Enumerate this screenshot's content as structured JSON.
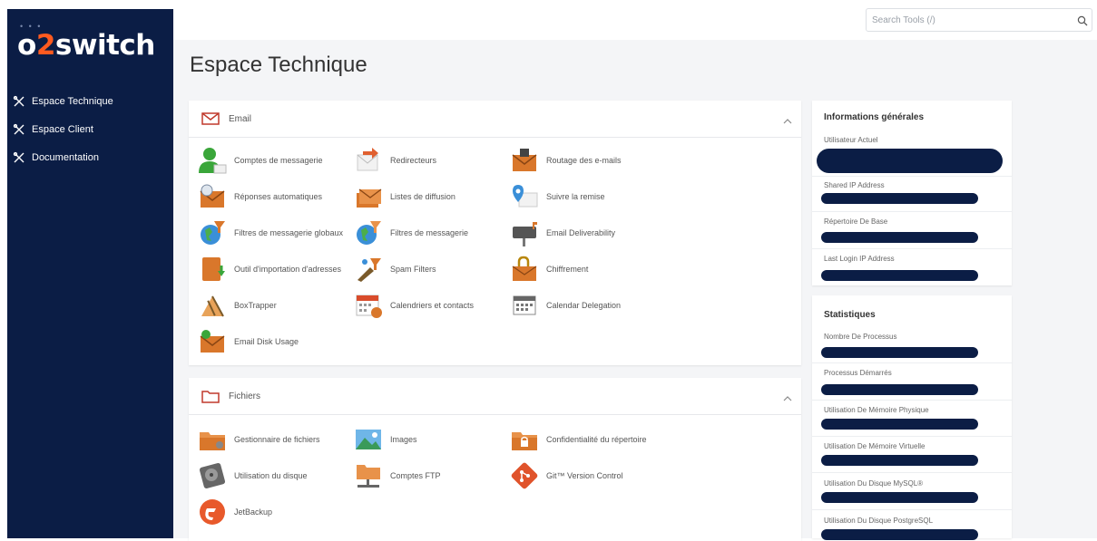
{
  "brand": {
    "logo_pre": "o",
    "logo_two": "2",
    "logo_post": "switch"
  },
  "sidebar": {
    "items": [
      {
        "label": "Espace Technique",
        "icon": "tools-icon"
      },
      {
        "label": "Espace Client",
        "icon": "tools-icon"
      },
      {
        "label": "Documentation",
        "icon": "tools-icon"
      }
    ]
  },
  "search": {
    "placeholder": "Search Tools (/)",
    "value": "",
    "icon": "search-icon"
  },
  "page_title": "Espace Technique",
  "email_section": {
    "title": "Email",
    "icon": "envelope-icon",
    "tools": [
      {
        "label": "Comptes de messagerie",
        "icon": "user-account-icon"
      },
      {
        "label": "Redirecteurs",
        "icon": "forwarders-icon"
      },
      {
        "label": "Routage des e-mails",
        "icon": "email-routing-icon"
      },
      {
        "label": "Réponses automatiques",
        "icon": "autoresponders-icon"
      },
      {
        "label": "Listes de diffusion",
        "icon": "mailing-lists-icon"
      },
      {
        "label": "Suivre la remise",
        "icon": "track-delivery-icon"
      },
      {
        "label": "Filtres de messagerie globaux",
        "icon": "global-filters-icon"
      },
      {
        "label": "Filtres de messagerie",
        "icon": "email-filters-icon"
      },
      {
        "label": "Email Deliverability",
        "icon": "deliverability-icon"
      },
      {
        "label": "Outil d'importation d'adresses",
        "icon": "address-importer-icon"
      },
      {
        "label": "Spam Filters",
        "icon": "spam-filters-icon"
      },
      {
        "label": "Chiffrement",
        "icon": "encryption-icon"
      },
      {
        "label": "BoxTrapper",
        "icon": "boxtrapper-icon"
      },
      {
        "label": "Calendriers et contacts",
        "icon": "calendar-contacts-icon"
      },
      {
        "label": "Calendar Delegation",
        "icon": "calendar-delegation-icon"
      },
      {
        "label": "Email Disk Usage",
        "icon": "email-disk-usage-icon"
      }
    ]
  },
  "files_section": {
    "title": "Fichiers",
    "icon": "folder-icon",
    "tools": [
      {
        "label": "Gestionnaire de fichiers",
        "icon": "file-manager-icon"
      },
      {
        "label": "Images",
        "icon": "images-icon"
      },
      {
        "label": "Confidentialité du répertoire",
        "icon": "directory-privacy-icon"
      },
      {
        "label": "Utilisation du disque",
        "icon": "disk-usage-icon"
      },
      {
        "label": "Comptes FTP",
        "icon": "ftp-accounts-icon"
      },
      {
        "label": "Git™ Version Control",
        "icon": "git-icon"
      },
      {
        "label": "JetBackup",
        "icon": "jetbackup-icon"
      }
    ]
  },
  "general_info": {
    "title": "Informations générales",
    "rows": [
      {
        "label": "Utilisateur Actuel"
      },
      {
        "label": "Shared IP Address"
      },
      {
        "label": "Répertoire De Base"
      },
      {
        "label": "Last Login IP Address"
      }
    ]
  },
  "stats": {
    "title": "Statistiques",
    "rows": [
      {
        "label": "Nombre De Processus"
      },
      {
        "label": "Processus Démarrés"
      },
      {
        "label": "Utilisation De Mémoire Physique"
      },
      {
        "label": "Utilisation De Mémoire Virtuelle"
      },
      {
        "label": "Utilisation Du Disque MySQL®"
      },
      {
        "label": "Utilisation Du Disque PostgreSQL"
      }
    ]
  },
  "colors": {
    "sidebar": "#0b1d45",
    "accent": "#ff5a1f",
    "redacted": "#0b1d45"
  }
}
